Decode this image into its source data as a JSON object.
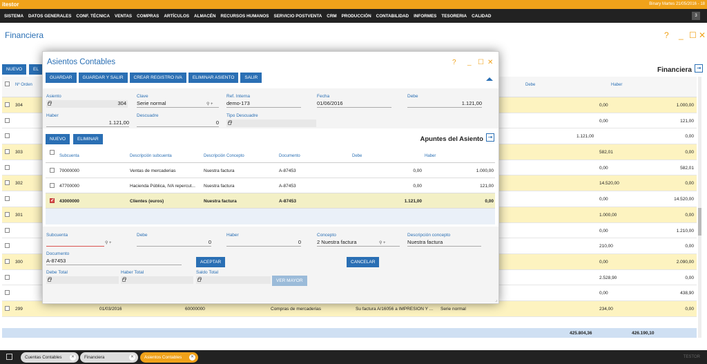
{
  "app": {
    "logo": "itestor",
    "top_info": "Binary Martes 21/05/2016 - 18",
    "user_count": "3",
    "footer_user": "TESTOR"
  },
  "menu": [
    "SISTEMA",
    "DATOS GENERALES",
    "CONF. TÉCNICA",
    "VENTAS",
    "COMPRAS",
    "ARTÍCULOS",
    "ALMACÉN",
    "RECURSOS HUMANOS",
    "SERVICIO POSTVENTA",
    "CRM",
    "PRODUCCIÓN",
    "CONTABILIDAD",
    "INFORMES",
    "TESORERIA",
    "CALIDAD"
  ],
  "page": {
    "title": "Financiera",
    "nuevo": "NUEVO",
    "el": "EL",
    "section_title": "Financiera"
  },
  "bg_table": {
    "headers": {
      "num_orden": "Nº Orden",
      "debe": "Debe",
      "haber": "Haber"
    },
    "rows": [
      {
        "num": "304",
        "debe": "",
        "haber": "",
        "d2": "0,00",
        "h2": "1.000,00",
        "yellow": true
      },
      {
        "num": "",
        "debe": "",
        "haber": "",
        "d2": "0,00",
        "h2": "121,00",
        "yellow": false
      },
      {
        "num": "",
        "debe": "",
        "haber": "",
        "d2": "1.121,00",
        "h2": "0,00",
        "yellow": false,
        "dcol": 1
      },
      {
        "num": "303",
        "debe": "",
        "haber": "",
        "d2": "582,01",
        "h2": "0,00",
        "yellow": true
      },
      {
        "num": "",
        "debe": "",
        "haber": "",
        "d2": "0,00",
        "h2": "582,01",
        "yellow": false
      },
      {
        "num": "302",
        "debe": "",
        "haber": "",
        "d2": "14.520,00",
        "h2": "0,00",
        "yellow": true
      },
      {
        "num": "",
        "debe": "",
        "haber": "",
        "d2": "0,00",
        "h2": "14.520,00",
        "yellow": false
      },
      {
        "num": "301",
        "debe": "",
        "haber": "",
        "d2": "1.000,00",
        "h2": "0,00",
        "yellow": true
      },
      {
        "num": "",
        "debe": "",
        "haber": "",
        "d2": "0,00",
        "h2": "1.210,00",
        "yellow": false
      },
      {
        "num": "",
        "debe": "",
        "haber": "",
        "d2": "210,00",
        "h2": "0,00",
        "yellow": false
      },
      {
        "num": "300",
        "debe": "",
        "haber": "",
        "d2": "0,00",
        "h2": "2.090,00",
        "yellow": true
      },
      {
        "num": "",
        "debe": "",
        "haber": "",
        "d2": "2.528,90",
        "h2": "0,00",
        "yellow": false
      },
      {
        "num": "",
        "debe": "",
        "haber": "",
        "d2": "0,00",
        "h2": "438,90",
        "yellow": false
      },
      {
        "num": "299",
        "fecha": "01/03/2016",
        "cuenta": "60000000",
        "concepto": "Compras de mercaderias",
        "doc": "Su factura A/16056 a IMPRESION Y ...",
        "serie": "Serie normal",
        "d2": "234,00",
        "h2": "0,00",
        "yellow": true
      }
    ],
    "total_debe": "425.804,36",
    "total_haber": "426.190,10"
  },
  "tabs": [
    {
      "label": "Cuentas Contables",
      "active": false
    },
    {
      "label": "Financiera",
      "active": false
    },
    {
      "label": "Asientos Contables",
      "active": true
    }
  ],
  "modal": {
    "title": "Asientos Contables",
    "buttons": [
      "GUARDAR",
      "GUARDAR Y SALIR",
      "CREAR REGISTRO IVA",
      "ELIMINAR ASIENTO",
      "SALIR"
    ],
    "fields": {
      "asiento_label": "Asiento",
      "asiento": "304",
      "clave_label": "Clave",
      "clave": "Serie normal",
      "ref_label": "Ref. Interna",
      "ref": "demo-173",
      "fecha_label": "Fecha",
      "fecha": "01/06/2016",
      "debe_label": "Debe",
      "debe": "1.121,00",
      "haber_label": "Haber",
      "haber": "1.121,00",
      "descuadre_label": "Descuadre",
      "descuadre": "0",
      "tipo_label": "Tipo Descuadre",
      "tipo": ""
    },
    "sub_nuevo": "NUEVO",
    "sub_eliminar": "ELIMINAR",
    "sub_title": "Apuntes del Asiento",
    "sub_headers": {
      "subcuenta": "Subcuenta",
      "desc_sub": "Descripción subcuenta",
      "desc_con": "Descripción Concepto",
      "documento": "Documento",
      "debe": "Debe",
      "haber": "Haber"
    },
    "sub_rows": [
      {
        "subcuenta": "70000000",
        "desc_sub": "Ventas de mercaderias",
        "desc_con": "Nuestra factura",
        "documento": "A-87453",
        "debe": "0,00",
        "haber": "1.000,00",
        "selected": false
      },
      {
        "subcuenta": "47700000",
        "desc_sub": "Hacienda Pública, IVA repercut...",
        "desc_con": "Nuestra factura",
        "documento": "A-87453",
        "debe": "0,00",
        "haber": "121,00",
        "selected": false
      },
      {
        "subcuenta": "43000000",
        "desc_sub": "Clientes (euros)",
        "desc_con": "Nuestra factura",
        "documento": "A-87453",
        "debe": "1.121,00",
        "haber": "0,00",
        "selected": true
      }
    ],
    "edit": {
      "subcuenta_label": "Subcuenta",
      "subcuenta": "",
      "debe_label": "Debe",
      "debe": "0",
      "haber_label": "Haber",
      "haber": "0",
      "concepto_label": "Concepto",
      "concepto": "2 Nuestra factura",
      "desc_concepto_label": "Descripción concepto",
      "desc_concepto": "Nuestra factura",
      "documento_label": "Documento",
      "documento": "A-87453",
      "aceptar": "ACEPTAR",
      "cancelar": "CANCELAR",
      "debe_total_label": "Debe Total",
      "haber_total_label": "Haber Total",
      "saldo_total_label": "Saldo Total",
      "ver_mayor": "VER MAYOR"
    }
  }
}
